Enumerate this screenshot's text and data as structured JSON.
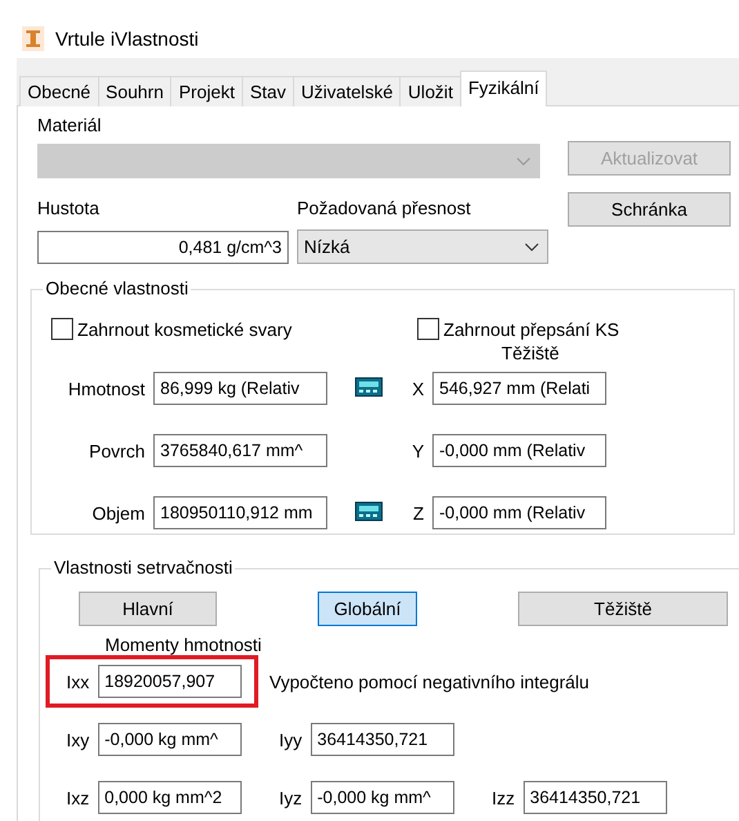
{
  "window": {
    "title": "Vrtule iVlastnosti"
  },
  "tabs": [
    {
      "label": "Obecné",
      "selected": false
    },
    {
      "label": "Souhrn",
      "selected": false
    },
    {
      "label": "Projekt",
      "selected": false
    },
    {
      "label": "Stav",
      "selected": false
    },
    {
      "label": "Uživatelské",
      "selected": false
    },
    {
      "label": "Uložit",
      "selected": false
    },
    {
      "label": "Fyzikální",
      "selected": true
    }
  ],
  "material": {
    "label": "Materiál",
    "disabled": true
  },
  "buttons": [
    {
      "label": "Aktualizovat",
      "disabled": true
    },
    {
      "label": "Schránka",
      "disabled": false
    }
  ],
  "density": {
    "label": "Hustota",
    "value": "0,481 g/cm^3"
  },
  "accuracy": {
    "label": "Požadovaná přesnost",
    "value": "Nízká"
  },
  "general": {
    "title": "Obecné vlastnosti",
    "centroid_title": "Těžiště",
    "checkboxes": [
      {
        "label": "Zahrnout kosmetické svary",
        "checked": false
      },
      {
        "label": "Zahrnout přepsání KS",
        "checked": false
      }
    ],
    "rows": [
      {
        "label": "Hmotnost",
        "value": "86,999 kg (Relativ",
        "calculator": true,
        "axis": "X",
        "axis_value": "546,927 mm (Relati"
      },
      {
        "label": "Povrch",
        "value": "3765840,617 mm^",
        "calculator": false,
        "axis": "Y",
        "axis_value": "-0,000 mm (Relativ"
      },
      {
        "label": "Objem",
        "value": "180950110,912 mm",
        "calculator": true,
        "axis": "Z",
        "axis_value": "-0,000 mm (Relativ"
      }
    ]
  },
  "inertia": {
    "title": "Vlastnosti setrvačnosti",
    "moments_title": "Momenty hmotnosti",
    "note": "Vypočteno pomocí negativního integrálu",
    "modes": [
      {
        "label": "Hlavní",
        "selected": false
      },
      {
        "label": "Globální",
        "selected": true
      },
      {
        "label": "Těžiště",
        "selected": false
      }
    ],
    "rows": [
      [
        {
          "label": "Ixx",
          "value": "18920057,907",
          "highlighted": true
        }
      ],
      [
        {
          "label": "Ixy",
          "value": "-0,000 kg mm^",
          "highlighted": false
        },
        {
          "label": "Iyy",
          "value": "36414350,721",
          "highlighted": false
        }
      ],
      [
        {
          "label": "Ixz",
          "value": "0,000 kg mm^2",
          "highlighted": false
        },
        {
          "label": "Iyz",
          "value": "-0,000 kg mm^",
          "highlighted": false
        },
        {
          "label": "Izz",
          "value": "36414350,721",
          "highlighted": false
        }
      ]
    ]
  }
}
